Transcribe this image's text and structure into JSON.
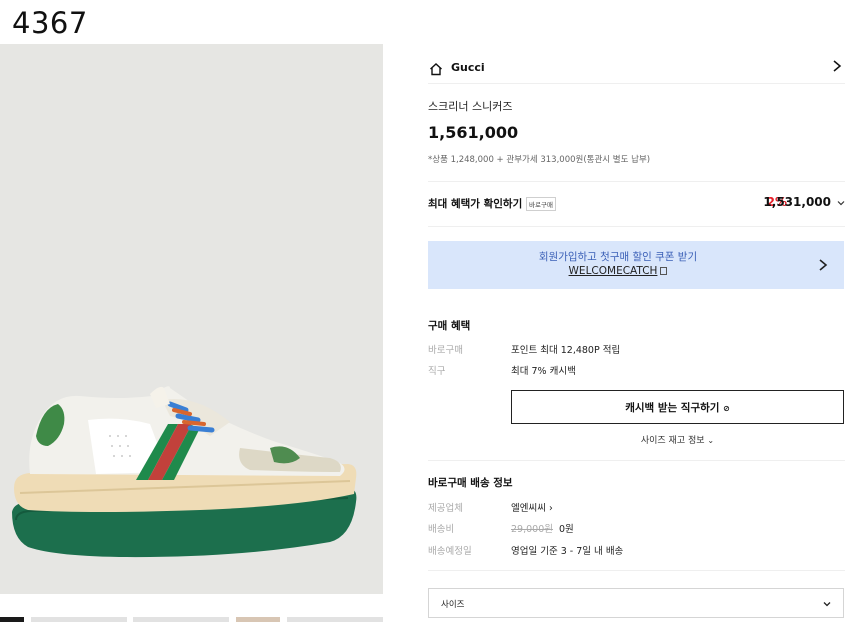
{
  "page": {
    "id_label": "4367"
  },
  "brand": {
    "name": "Gucci",
    "home_icon": "home-icon",
    "chevron": "chevron-right-icon"
  },
  "product": {
    "name": "스크리너 스니커즈",
    "price": "1,561,000",
    "price_detail": "*상품 1,248,000 + 관부가세 313,000원(통관시 별도 납부)"
  },
  "benefit": {
    "title": "최대 혜택가 확인하기",
    "badge": "바로구매",
    "percent": "2%",
    "price": "1,531,000"
  },
  "coupon": {
    "text": "회원가입하고 첫구매 할인 쿠폰 받기",
    "code": "WELCOMECATCH"
  },
  "purchase_benefits": {
    "title": "구매 혜택",
    "rows": [
      {
        "label": "바로구매",
        "value": "포인트 최대 12,480P 적립"
      },
      {
        "label": "직구",
        "value": "최대 7% 캐시백"
      }
    ],
    "cta": "캐시백 받는 직구하기",
    "size_stock": "사이즈 재고 정보"
  },
  "shipping": {
    "title": "바로구매 배송 정보",
    "rows": [
      {
        "label": "제공업체",
        "value": "엘엔씨씨"
      },
      {
        "label": "배송비",
        "original": "29,000원",
        "value": "0원"
      },
      {
        "label": "배송예정일",
        "value": "영업일 기준 3 - 7일 내 배송"
      }
    ]
  },
  "size_select": {
    "label": "사이즈"
  },
  "colors": {
    "accent_red": "#e8202a",
    "coupon_bg": "#d9e6fb",
    "coupon_text": "#3b60b7"
  }
}
